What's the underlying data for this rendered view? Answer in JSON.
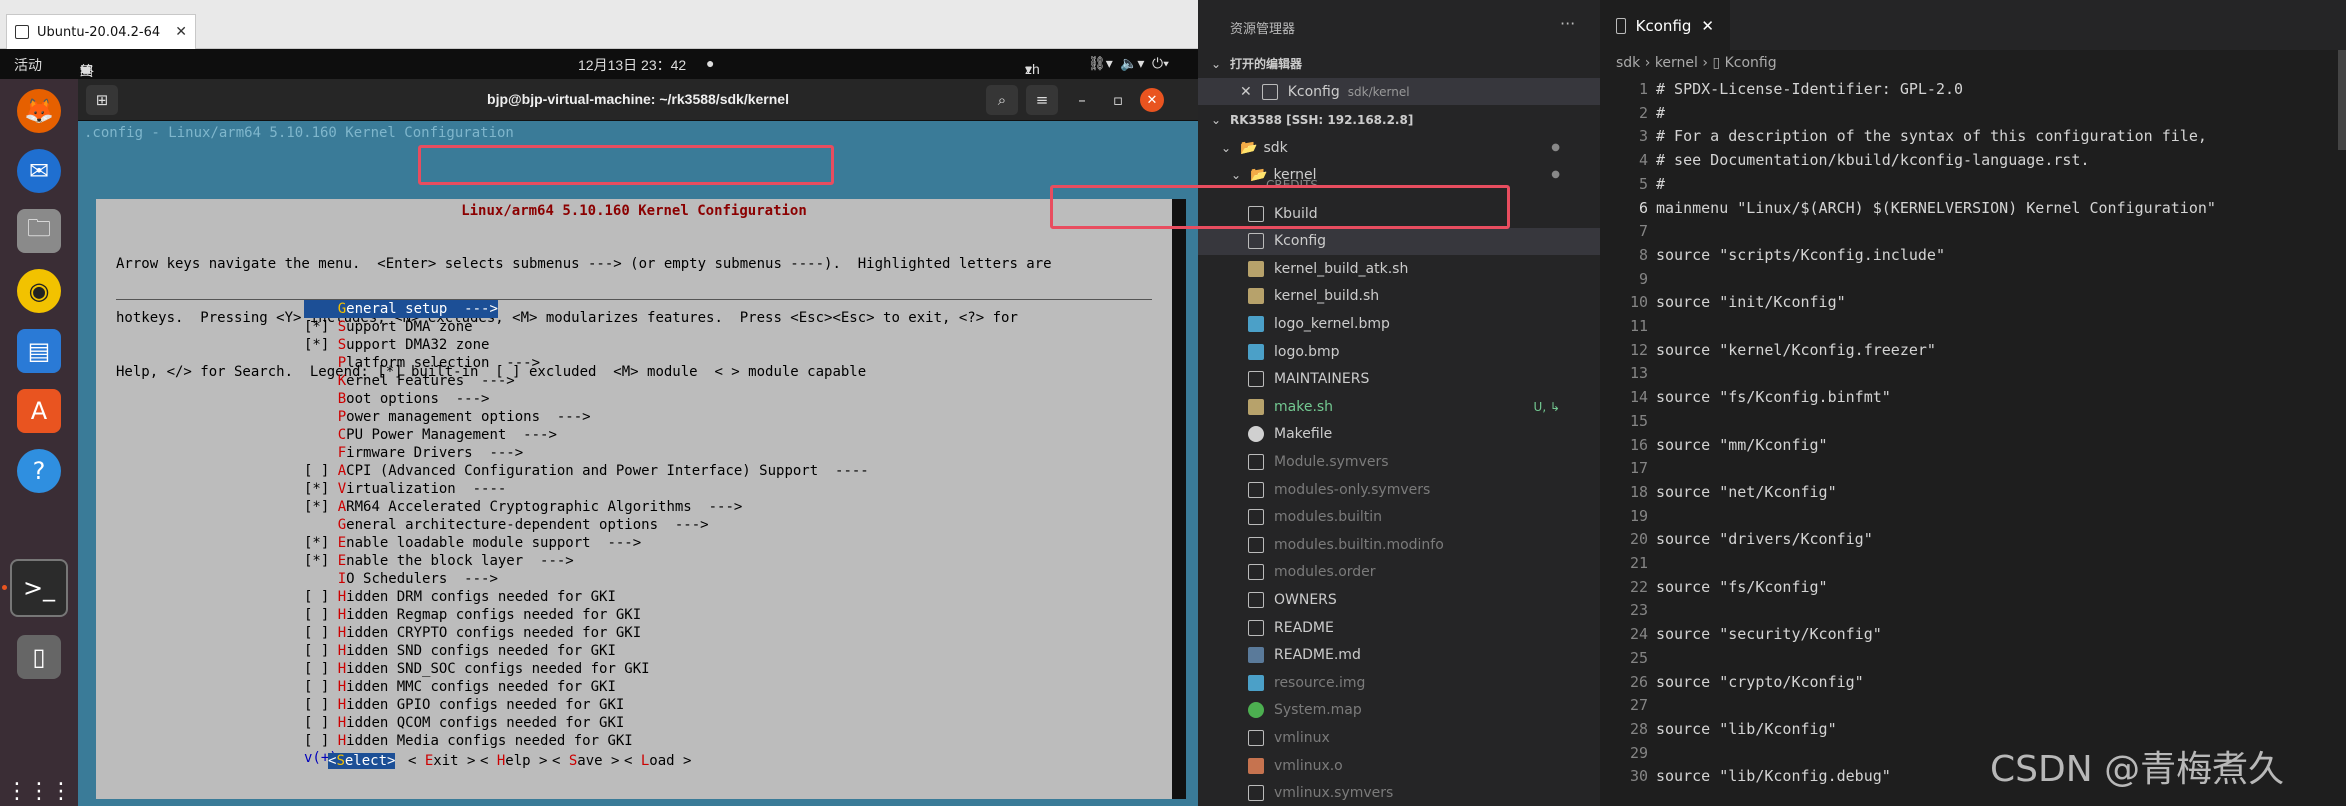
{
  "vm": {
    "tab_title": "Ubuntu-20.04.2-64",
    "tab_close": "✕"
  },
  "gnome_topbar": {
    "activities": "活动",
    "app_menu": "终端",
    "clock": "12月13日 23：42",
    "lang": "zh",
    "icons": [
      "network-icon",
      "volume-icon",
      "power-icon"
    ]
  },
  "dock_icons": [
    "firefox-icon",
    "thunderbird-icon",
    "files-icon",
    "rhythmbox-icon",
    "writer-icon",
    "software-center-icon",
    "help-icon",
    "terminal-icon",
    "device-icon",
    "app-grid-icon"
  ],
  "terminal": {
    "title": "bjp@bjp-virtual-machine: ~/rk3588/sdk/kernel"
  },
  "menuconfig": {
    "header_line": ".config - Linux/arm64 5.10.160 Kernel Configuration",
    "dialog_title": "Linux/arm64 5.10.160 Kernel Configuration",
    "help_lines": [
      "Arrow keys navigate the menu.  <Enter> selects submenus ---> (or empty submenus ----).  Highlighted letters are",
      "hotkeys.  Pressing <Y> includes, <N> excludes, <M> modularizes features.  Press <Esc><Esc> to exit, <?> for",
      "Help, </> for Search.  Legend: [*] built-in  [ ] excluded  <M> module  < > module capable"
    ],
    "items": [
      {
        "prefix": "    ",
        "hot": "G",
        "rest": "eneral setup  --->",
        "selected": true
      },
      {
        "prefix": "[*] ",
        "hot": "S",
        "rest": "upport DMA zone"
      },
      {
        "prefix": "[*] ",
        "hot": "S",
        "rest": "upport DMA32 zone"
      },
      {
        "prefix": "    ",
        "hot": "P",
        "rest": "latform selection  --->"
      },
      {
        "prefix": "    ",
        "hot": "K",
        "rest": "ernel Features  --->"
      },
      {
        "prefix": "    ",
        "hot": "B",
        "rest": "oot options  --->"
      },
      {
        "prefix": "    ",
        "hot": "P",
        "rest": "ower management options  --->"
      },
      {
        "prefix": "    ",
        "hot": "C",
        "rest": "PU Power Management  --->"
      },
      {
        "prefix": "    ",
        "hot": "F",
        "rest": "irmware Drivers  --->"
      },
      {
        "prefix": "[ ] ",
        "hot": "A",
        "rest": "CPI (Advanced Configuration and Power Interface) Support  ----"
      },
      {
        "prefix": "[*] ",
        "hot": "V",
        "rest": "irtualization  ----"
      },
      {
        "prefix": "[*] ",
        "hot": "A",
        "rest": "RM64 Accelerated Cryptographic Algorithms  --->"
      },
      {
        "prefix": "    ",
        "hot": "G",
        "rest": "eneral architecture-dependent options  --->"
      },
      {
        "prefix": "[*] ",
        "hot": "E",
        "rest": "nable loadable module support  --->"
      },
      {
        "prefix": "[*] ",
        "hot": "E",
        "rest": "nable the block layer  --->"
      },
      {
        "prefix": "    ",
        "hot": "I",
        "rest": "O Schedulers  --->"
      },
      {
        "prefix": "[ ] ",
        "hot": "H",
        "rest": "idden DRM configs needed for GKI"
      },
      {
        "prefix": "[ ] ",
        "hot": "H",
        "rest": "idden Regmap configs needed for GKI"
      },
      {
        "prefix": "[ ] ",
        "hot": "H",
        "rest": "idden CRYPTO configs needed for GKI"
      },
      {
        "prefix": "[ ] ",
        "hot": "H",
        "rest": "idden SND configs needed for GKI"
      },
      {
        "prefix": "[ ] ",
        "hot": "H",
        "rest": "idden SND_SOC configs needed for GKI"
      },
      {
        "prefix": "[ ] ",
        "hot": "H",
        "rest": "idden MMC configs needed for GKI"
      },
      {
        "prefix": "[ ] ",
        "hot": "H",
        "rest": "idden GPIO configs needed for GKI"
      },
      {
        "prefix": "[ ] ",
        "hot": "H",
        "rest": "idden QCOM configs needed for GKI"
      },
      {
        "prefix": "[ ] ",
        "hot": "H",
        "rest": "idden Media configs needed for GKI"
      }
    ],
    "more": "v(+)",
    "buttons": [
      {
        "pre": "<",
        "hot": "S",
        "rest": "elect>",
        "selected": true
      },
      {
        "pre": "< ",
        "hot": "E",
        "rest": "xit >"
      },
      {
        "pre": "< ",
        "hot": "H",
        "rest": "elp >"
      },
      {
        "pre": "< ",
        "hot": "S",
        "rest": "ave >"
      },
      {
        "pre": "< ",
        "hot": "L",
        "rest": "oad >"
      }
    ]
  },
  "vscode": {
    "explorer_title": "资源管理器",
    "open_editors": "打开的编辑器",
    "open_file": "Kconfig",
    "open_file_path": "sdk/kernel",
    "workspace": "RK3588 [SSH: 192.168.2.8]",
    "folder_sdk": "sdk",
    "folder_kernel": "kernel",
    "partial_item": "CREDITS",
    "files": [
      {
        "name": "Kbuild",
        "icon": "doc",
        "dim": false
      },
      {
        "name": "Kconfig",
        "icon": "doc",
        "dim": false,
        "active": true
      },
      {
        "name": "kernel_build_atk.sh",
        "icon": "sh",
        "dim": false
      },
      {
        "name": "kernel_build.sh",
        "icon": "sh",
        "dim": false
      },
      {
        "name": "logo_kernel.bmp",
        "icon": "img",
        "dim": false
      },
      {
        "name": "logo.bmp",
        "icon": "img",
        "dim": false
      },
      {
        "name": "MAINTAINERS",
        "icon": "doc",
        "dim": false
      },
      {
        "name": "make.sh",
        "icon": "sh",
        "dim": false,
        "modified": true,
        "badge": "U, ↳"
      },
      {
        "name": "Makefile",
        "icon": "git",
        "dim": false
      },
      {
        "name": "Module.symvers",
        "icon": "doc",
        "dim": true
      },
      {
        "name": "modules-only.symvers",
        "icon": "doc",
        "dim": true
      },
      {
        "name": "modules.builtin",
        "icon": "doc",
        "dim": true
      },
      {
        "name": "modules.builtin.modinfo",
        "icon": "doc",
        "dim": true
      },
      {
        "name": "modules.order",
        "icon": "doc",
        "dim": true
      },
      {
        "name": "OWNERS",
        "icon": "doc",
        "dim": false
      },
      {
        "name": "README",
        "icon": "doc",
        "dim": false
      },
      {
        "name": "README.md",
        "icon": "md",
        "dim": false
      },
      {
        "name": "resource.img",
        "icon": "img",
        "dim": true
      },
      {
        "name": "System.map",
        "icon": "globe",
        "dim": true
      },
      {
        "name": "vmlinux",
        "icon": "doc",
        "dim": true
      },
      {
        "name": "vmlinux.o",
        "icon": "vm",
        "dim": true
      },
      {
        "name": "vmlinux.symvers",
        "icon": "doc",
        "dim": true
      }
    ],
    "tab_label": "Kconfig",
    "tab_close": "✕",
    "breadcrumb": [
      "sdk",
      "kernel",
      "Kconfig"
    ],
    "code_lines": [
      {
        "n": "1",
        "t": "# SPDX-License-Identifier: GPL-2.0"
      },
      {
        "n": "2",
        "t": "#"
      },
      {
        "n": "3",
        "t": "# For a description of the syntax of this configuration file,"
      },
      {
        "n": "4",
        "t": "# see Documentation/kbuild/kconfig-language.rst."
      },
      {
        "n": "5",
        "t": "#"
      },
      {
        "n": "6",
        "t": "mainmenu \"Linux/$(ARCH) $(KERNELVERSION) Kernel Configuration\""
      },
      {
        "n": "7",
        "t": ""
      },
      {
        "n": "8",
        "t": "source \"scripts/Kconfig.include\""
      },
      {
        "n": "9",
        "t": ""
      },
      {
        "n": "10",
        "t": "source \"init/Kconfig\""
      },
      {
        "n": "11",
        "t": ""
      },
      {
        "n": "12",
        "t": "source \"kernel/Kconfig.freezer\""
      },
      {
        "n": "13",
        "t": ""
      },
      {
        "n": "14",
        "t": "source \"fs/Kconfig.binfmt\""
      },
      {
        "n": "15",
        "t": ""
      },
      {
        "n": "16",
        "t": "source \"mm/Kconfig\""
      },
      {
        "n": "17",
        "t": ""
      },
      {
        "n": "18",
        "t": "source \"net/Kconfig\""
      },
      {
        "n": "19",
        "t": ""
      },
      {
        "n": "20",
        "t": "source \"drivers/Kconfig\""
      },
      {
        "n": "21",
        "t": ""
      },
      {
        "n": "22",
        "t": "source \"fs/Kconfig\""
      },
      {
        "n": "23",
        "t": ""
      },
      {
        "n": "24",
        "t": "source \"security/Kconfig\""
      },
      {
        "n": "25",
        "t": ""
      },
      {
        "n": "26",
        "t": "source \"crypto/Kconfig\""
      },
      {
        "n": "27",
        "t": ""
      },
      {
        "n": "28",
        "t": "source \"lib/Kconfig\""
      },
      {
        "n": "29",
        "t": ""
      },
      {
        "n": "30",
        "t": "source \"lib/Kconfig.debug\""
      }
    ]
  },
  "watermark": "CSDN @青梅煮久",
  "colors": {
    "highlight_box": "#e84d5f",
    "menuconfig_bg": "#3a7b98",
    "selection": "#1c4f96"
  }
}
